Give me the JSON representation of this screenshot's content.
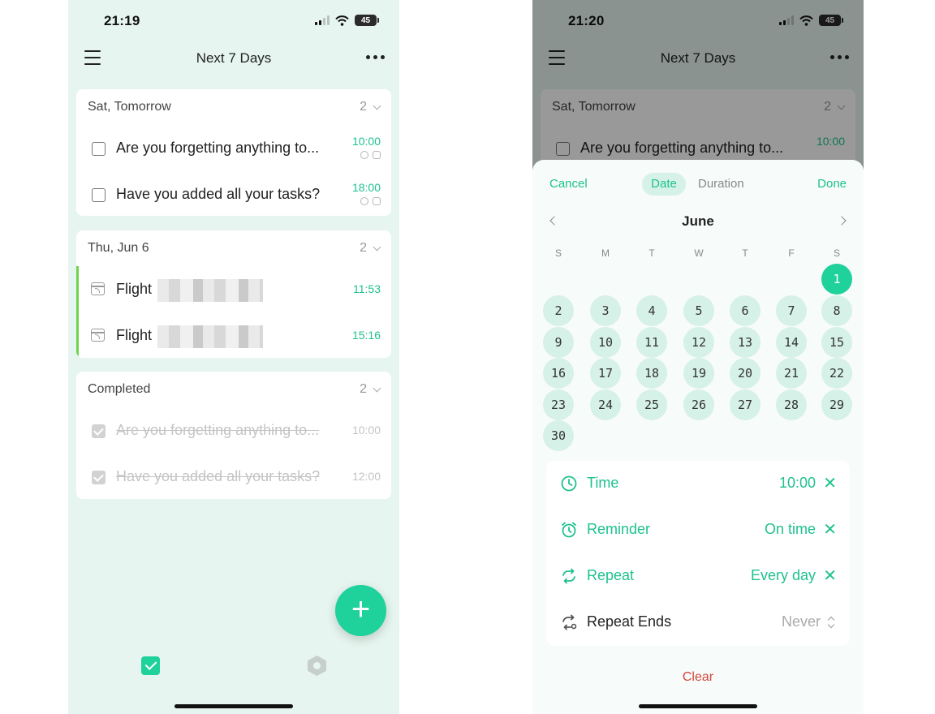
{
  "left": {
    "status": {
      "time": "21:19",
      "battery": "45"
    },
    "header": {
      "title": "Next 7 Days"
    },
    "sections": [
      {
        "title": "Sat, Tomorrow",
        "count": "2",
        "tasks": [
          {
            "title": "Are you forgetting anything to...",
            "time": "10:00",
            "icons": [
              "alarm-icon",
              "repeat-icon"
            ]
          },
          {
            "title": "Have you added all your tasks?",
            "time": "18:00",
            "icons": [
              "alarm-icon",
              "repeat-icon"
            ]
          }
        ]
      },
      {
        "title": "Thu, Jun 6",
        "count": "2",
        "accent_color": "#6fd34e",
        "tasks": [
          {
            "title": "Flight",
            "time": "11:53",
            "icon": "calendar-event-icon"
          },
          {
            "title": "Flight",
            "time": "15:16",
            "icon": "calendar-event-icon"
          }
        ]
      },
      {
        "title": "Completed",
        "count": "2",
        "tasks": [
          {
            "title": "Are you forgetting anything to...",
            "time": "10:00"
          },
          {
            "title": "Have you added all your tasks?",
            "time": "12:00"
          }
        ]
      }
    ],
    "fab_label": "+",
    "tabbar": [
      "tasks-check-icon",
      "habit-hex-icon"
    ]
  },
  "right": {
    "status": {
      "time": "21:20",
      "battery": "45"
    },
    "header": {
      "title": "Next 7 Days"
    },
    "background_section": {
      "title": "Sat, Tomorrow",
      "count": "2",
      "task_title": "Are you forgetting anything to...",
      "task_time": "10:00"
    },
    "sheet": {
      "cancel": "Cancel",
      "done": "Done",
      "tabs": [
        "Date",
        "Duration"
      ],
      "active_tab": "Date",
      "month": "June",
      "weekdays": [
        "S",
        "M",
        "T",
        "W",
        "T",
        "F",
        "S"
      ],
      "first_weekday_index": 6,
      "days_in_month": 30,
      "selected_day": 1,
      "rows": [
        {
          "label": "Time",
          "value": "10:00",
          "icon": "clock-icon",
          "clearable": true
        },
        {
          "label": "Reminder",
          "value": "On time",
          "icon": "alarm-icon",
          "clearable": true
        },
        {
          "label": "Repeat",
          "value": "Every day",
          "icon": "repeat-icon",
          "clearable": true
        },
        {
          "label": "Repeat Ends",
          "value": "Never",
          "icon": "repeat-end-icon",
          "clearable": false
        }
      ],
      "clear": "Clear"
    }
  },
  "colors": {
    "accent": "#1fd19b",
    "accent_text": "#1fc18f",
    "background": "#e6f5ef",
    "danger": "#d3463d"
  }
}
